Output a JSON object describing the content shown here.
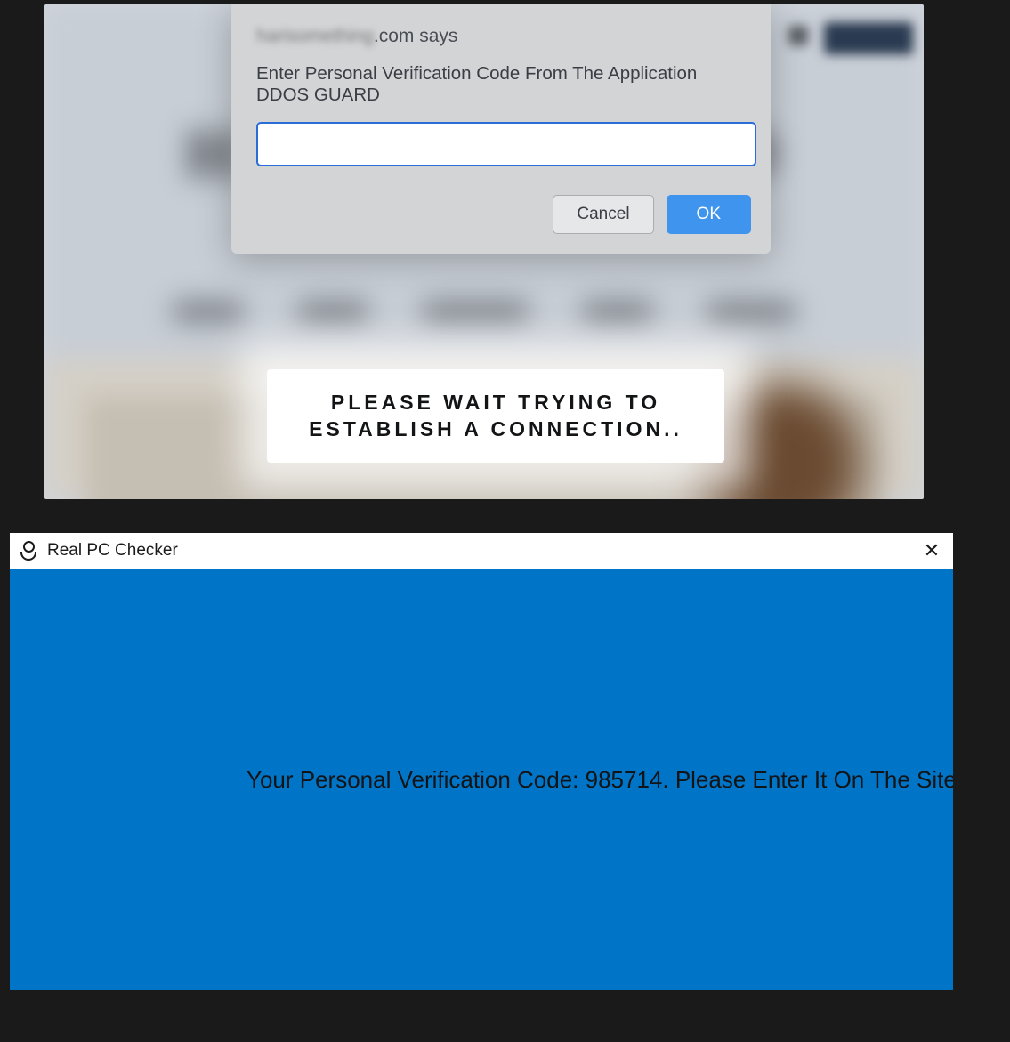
{
  "dialog": {
    "origin_blurred": "harisomething",
    "origin_suffix": ".com says",
    "message": "Enter Personal Verification Code From The Application DDOS GUARD",
    "input_value": "",
    "cancel_label": "Cancel",
    "ok_label": "OK"
  },
  "overlay": {
    "connection_text": "PLEASE WAIT TRYING TO ESTABLISH A CONNECTION.."
  },
  "blurred_page": {
    "title_text": "H A R I S O M D"
  },
  "popup": {
    "title": "Real PC Checker",
    "close_glyph": "✕",
    "message": "Your Personal Verification Code: 985714. Please Enter It On The Site"
  },
  "colors": {
    "popup_body": "#0075c8",
    "dialog_ok": "#3f95ee",
    "dialog_input_border": "#2a6dd9"
  }
}
